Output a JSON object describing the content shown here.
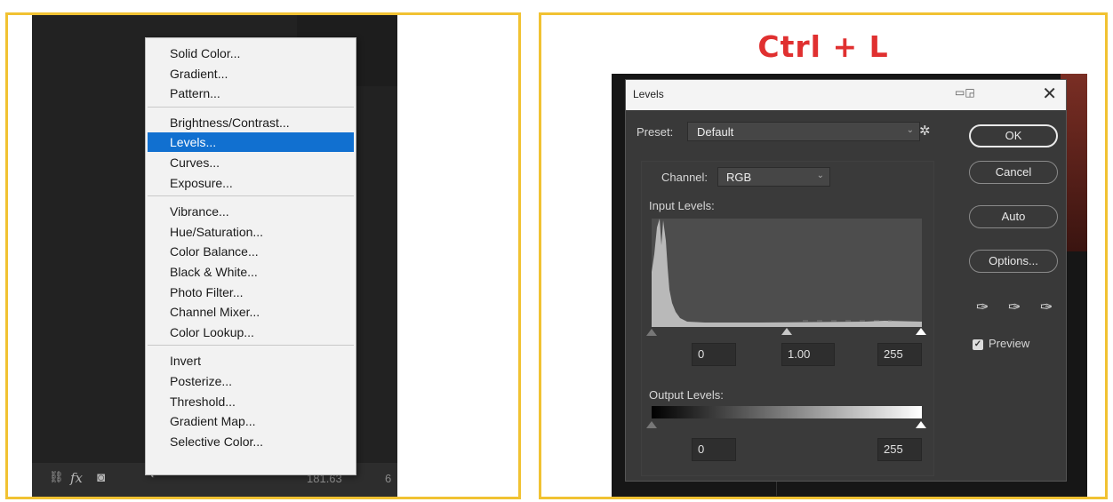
{
  "left_menu": {
    "groups": [
      [
        "Solid Color...",
        "Gradient...",
        "Pattern..."
      ],
      [
        "Brightness/Contrast...",
        "Levels...",
        "Curves...",
        "Exposure..."
      ],
      [
        "Vibrance...",
        "Hue/Saturation...",
        "Color Balance...",
        "Black & White...",
        "Photo Filter...",
        "Channel Mixer...",
        "Color Lookup..."
      ],
      [
        "Invert",
        "Posterize...",
        "Threshold...",
        "Gradient Map...",
        "Selective Color..."
      ]
    ],
    "selected": "Levels...",
    "bottom_bar": {
      "fx_label": "fx",
      "value": "181.63",
      "value2": "6"
    }
  },
  "right": {
    "shortcut_title": "Ctrl + L",
    "dialog": {
      "title": "Levels",
      "preset_label": "Preset:",
      "preset_value": "Default",
      "channel_label": "Channel:",
      "channel_value": "RGB",
      "input_levels_label": "Input Levels:",
      "input_black": "0",
      "input_gamma": "1.00",
      "input_white": "255",
      "output_levels_label": "Output Levels:",
      "output_black": "0",
      "output_white": "255",
      "buttons": {
        "ok": "OK",
        "cancel": "Cancel",
        "auto": "Auto",
        "options": "Options..."
      },
      "preview_label": "Preview",
      "preview_checked": true
    }
  },
  "colors": {
    "frame_border": "#f1c232",
    "menu_highlight": "#1170d0",
    "shortcut_red": "#e03030"
  }
}
